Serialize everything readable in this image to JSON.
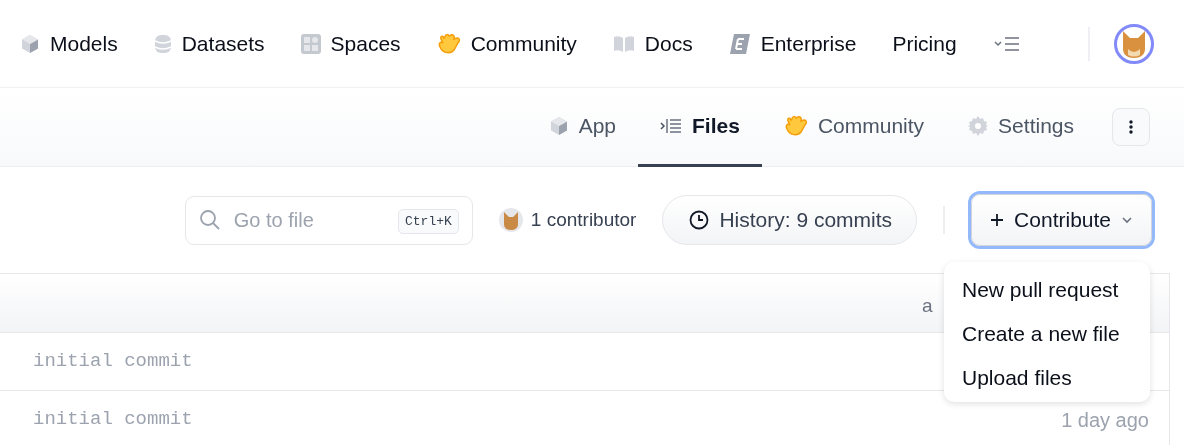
{
  "nav": {
    "items": [
      {
        "label": "Models"
      },
      {
        "label": "Datasets"
      },
      {
        "label": "Spaces"
      },
      {
        "label": "Community"
      },
      {
        "label": "Docs"
      },
      {
        "label": "Enterprise"
      },
      {
        "label": "Pricing"
      }
    ]
  },
  "tabs": [
    {
      "label": "App",
      "selected": false
    },
    {
      "label": "Files",
      "selected": true
    },
    {
      "label": "Community",
      "selected": false
    },
    {
      "label": "Settings",
      "selected": false
    }
  ],
  "toolbar": {
    "search": {
      "placeholder": "Go to file",
      "shortcut": "Ctrl+K"
    },
    "contributors": "1 contributor",
    "history": "History: 9 commits",
    "contribute": {
      "label": "Contribute",
      "expanded": true
    }
  },
  "menu": {
    "items": [
      "New pull request",
      "Create a new file",
      "Upload files"
    ]
  },
  "table": {
    "header_text": "a",
    "rows": [
      {
        "message": "initial commit"
      },
      {
        "message": "initial commit",
        "time": "1 day ago"
      }
    ]
  }
}
